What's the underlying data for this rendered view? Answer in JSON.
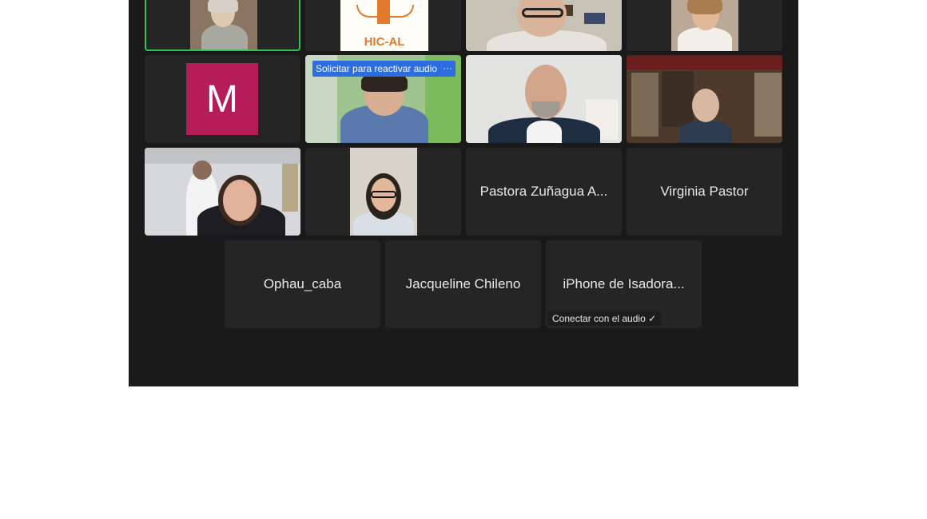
{
  "participants": [
    {
      "id": "p1",
      "name": ""
    },
    {
      "id": "p2",
      "logo_text": "HIC-AL"
    },
    {
      "id": "p3",
      "name": ""
    },
    {
      "id": "p4",
      "name": ""
    },
    {
      "id": "p5",
      "avatar_initial": "M"
    },
    {
      "id": "p6",
      "request_label": "Solicitar para reactivar audio",
      "more_label": "···"
    },
    {
      "id": "p7",
      "name": ""
    },
    {
      "id": "p8",
      "name": ""
    },
    {
      "id": "p9",
      "name": ""
    },
    {
      "id": "p10",
      "name": ""
    },
    {
      "id": "p11",
      "name": "Pastora Zuñagua A..."
    },
    {
      "id": "p12",
      "name": "Virginia Pastor"
    },
    {
      "id": "p13",
      "name": "Ophau_caba"
    },
    {
      "id": "p14",
      "name": "Jacqueline Chileno"
    },
    {
      "id": "p15",
      "name": "iPhone de Isadora...",
      "audio_label": "Conectar con el audio ✓"
    }
  ],
  "colors": {
    "background": "#1a1a1a",
    "tile": "#252525",
    "active_speaker": "#34c15a",
    "request_button": "#2c6de0",
    "avatar_m": "#b51d59"
  }
}
